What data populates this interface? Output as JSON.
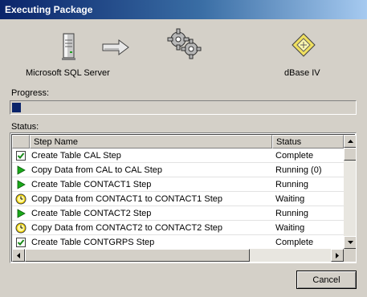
{
  "window": {
    "title": "Executing Package"
  },
  "source": {
    "label": "Microsoft SQL Server",
    "icon": "database-server-icon"
  },
  "transfer": {
    "icon": "arrow-right-icon"
  },
  "engine": {
    "icon": "gears-icon"
  },
  "destination": {
    "label": "dBase IV",
    "icon": "dbase-file-icon"
  },
  "progress": {
    "label": "Progress:",
    "fraction": 0.025,
    "color": "#0a246a"
  },
  "status": {
    "label": "Status:",
    "columns": [
      "Step Name",
      "Status"
    ],
    "rows": [
      {
        "icon": "check-icon",
        "name": "Create Table CAL Step",
        "status": "Complete"
      },
      {
        "icon": "play-icon",
        "name": "Copy Data from CAL to CAL Step",
        "status": "Running (0)"
      },
      {
        "icon": "play-icon",
        "name": "Create Table CONTACT1 Step",
        "status": "Running"
      },
      {
        "icon": "clock-icon",
        "name": "Copy Data from CONTACT1 to CONTACT1 Step",
        "status": "Waiting"
      },
      {
        "icon": "play-icon",
        "name": "Create Table CONTACT2 Step",
        "status": "Running"
      },
      {
        "icon": "clock-icon",
        "name": "Copy Data from CONTACT2 to CONTACT2 Step",
        "status": "Waiting"
      },
      {
        "icon": "check-icon",
        "name": "Create Table CONTGRPS Step",
        "status": "Complete"
      }
    ]
  },
  "buttons": {
    "cancel": "Cancel"
  },
  "colors": {
    "title_bar": "#0a246a",
    "face": "#d4d0c8",
    "check": "#1a8a1a",
    "play": "#1aaa1a",
    "clock": "#f0d000"
  }
}
